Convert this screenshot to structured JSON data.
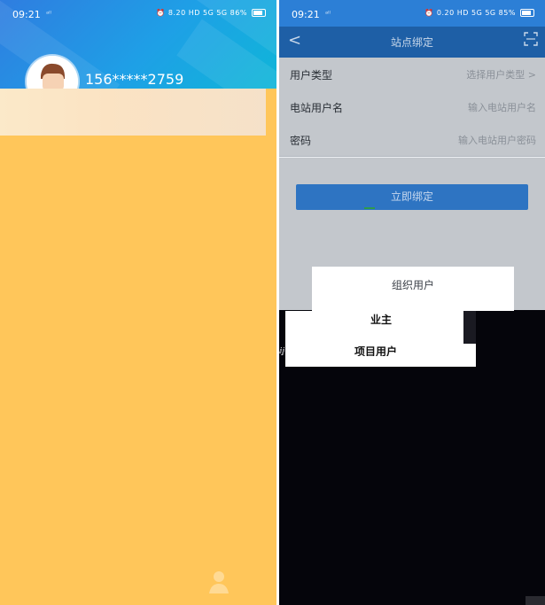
{
  "left": {
    "status": {
      "time": "09:21",
      "network": "ᵃˡˡ",
      "right": "⏰ 8.20 HD 5G 5G",
      "battery": "86%"
    },
    "user": {
      "phone": "156*****2759"
    }
  },
  "right": {
    "status": {
      "time": "09:21",
      "network": "ᵃˡˡ",
      "right": "⏰ 0.20 HD 5G 5G",
      "battery": "85%"
    },
    "nav": {
      "title": "站点绑定",
      "back": "<"
    },
    "form": [
      {
        "label": "用户类型",
        "value": "选择用户类型 >"
      },
      {
        "label": "电站用户名",
        "value": "输入电站用户名"
      },
      {
        "label": "密码",
        "value": "输入电站用户密码"
      }
    ],
    "bind_button": "立即绑定",
    "options": {
      "org": "组织用户",
      "owner": "业主",
      "project": "项目用户"
    },
    "glitch1": "ⅈⅉ",
    "glitch2": "ⅈⅉ"
  },
  "colors": {
    "left_header": "#2f7de0",
    "left_body": "#ffc65a",
    "right_header": "#1e5fa6",
    "button": "#2e74c2",
    "overlay_dark": "#05050b"
  }
}
